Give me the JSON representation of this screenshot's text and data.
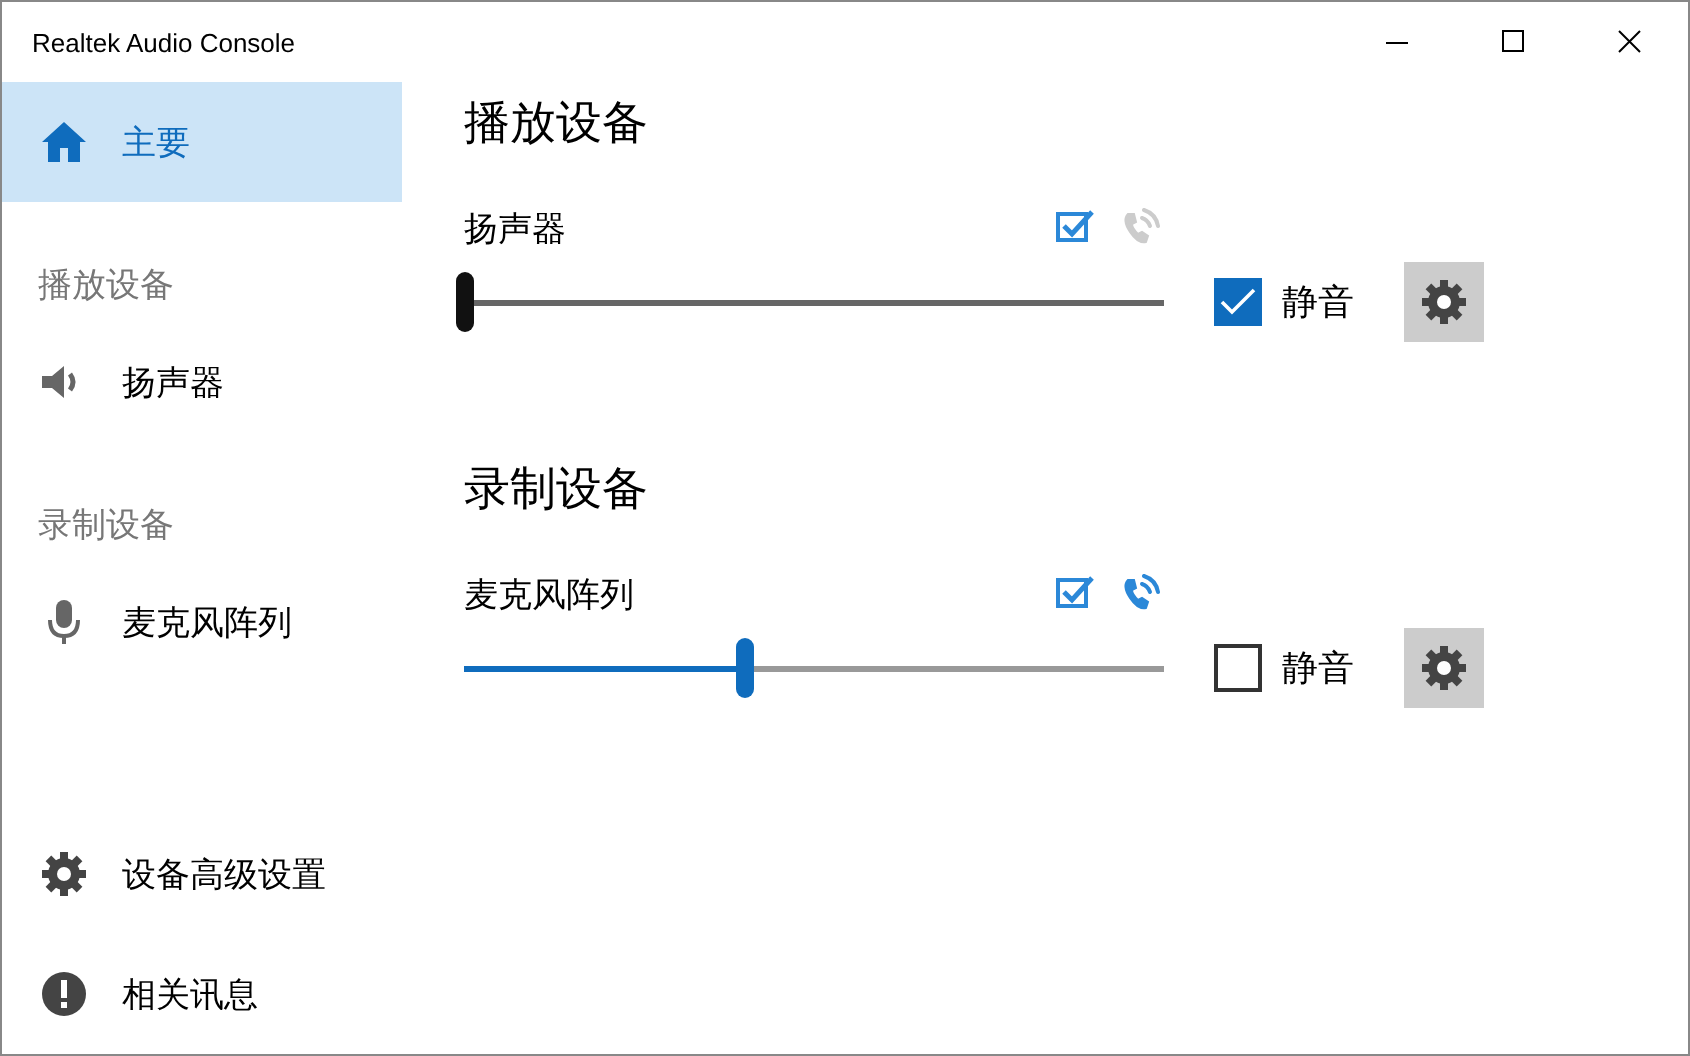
{
  "window": {
    "title": "Realtek Audio Console"
  },
  "sidebar": {
    "items": [
      {
        "kind": "home",
        "label": "主要",
        "selected": true
      },
      {
        "kind": "heading",
        "label": "播放设备",
        "selected": false
      },
      {
        "kind": "speaker",
        "label": "扬声器",
        "selected": false
      },
      {
        "kind": "heading",
        "label": "录制设备",
        "selected": false
      },
      {
        "kind": "microphone",
        "label": "麦克风阵列",
        "selected": false
      }
    ],
    "bottom_items": [
      {
        "kind": "settings",
        "label": "设备高级设置",
        "selected": false
      },
      {
        "kind": "info",
        "label": "相关讯息",
        "selected": false
      }
    ]
  },
  "sections": [
    {
      "title": "播放设备",
      "device": "扬声器",
      "default_device": true,
      "default_communication": false,
      "level": 0,
      "mute_label": "静音",
      "muted": true
    },
    {
      "title": "录制设备",
      "device": "麦克风阵列",
      "default_device": true,
      "default_communication": true,
      "level": 0.4,
      "mute_label": "静音",
      "muted": false
    }
  ]
}
